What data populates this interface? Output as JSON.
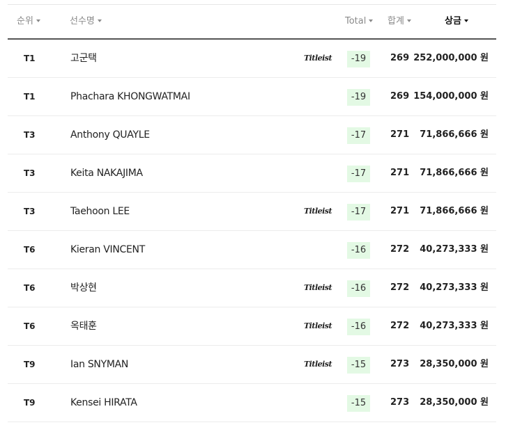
{
  "header": {
    "rank": "순위",
    "name": "선수명",
    "total": "Total",
    "sum": "합계",
    "prize": "상금"
  },
  "sponsor_logo": "Titleist",
  "currency": "원",
  "rows": [
    {
      "rank": "T1",
      "name": "고군택",
      "sponsor": "Titleist",
      "total": "-19",
      "sum": "269",
      "prize": "252,000,000 원"
    },
    {
      "rank": "T1",
      "name": "Phachara KHONGWATMAI",
      "sponsor": "",
      "total": "-19",
      "sum": "269",
      "prize": "154,000,000 원"
    },
    {
      "rank": "T3",
      "name": "Anthony QUAYLE",
      "sponsor": "",
      "total": "-17",
      "sum": "271",
      "prize": "71,866,666 원"
    },
    {
      "rank": "T3",
      "name": "Keita NAKAJIMA",
      "sponsor": "",
      "total": "-17",
      "sum": "271",
      "prize": "71,866,666 원"
    },
    {
      "rank": "T3",
      "name": "Taehoon LEE",
      "sponsor": "Titleist",
      "total": "-17",
      "sum": "271",
      "prize": "71,866,666 원"
    },
    {
      "rank": "T6",
      "name": "Kieran VINCENT",
      "sponsor": "",
      "total": "-16",
      "sum": "272",
      "prize": "40,273,333 원"
    },
    {
      "rank": "T6",
      "name": "박상현",
      "sponsor": "Titleist",
      "total": "-16",
      "sum": "272",
      "prize": "40,273,333 원"
    },
    {
      "rank": "T6",
      "name": "옥태훈",
      "sponsor": "Titleist",
      "total": "-16",
      "sum": "272",
      "prize": "40,273,333 원"
    },
    {
      "rank": "T9",
      "name": "Ian SNYMAN",
      "sponsor": "Titleist",
      "total": "-15",
      "sum": "273",
      "prize": "28,350,000 원"
    },
    {
      "rank": "T9",
      "name": "Kensei HIRATA",
      "sponsor": "",
      "total": "-15",
      "sum": "273",
      "prize": "28,350,000 원"
    }
  ],
  "colors": {
    "score_badge_bg": "#e3f9e4",
    "header_text": "#8a8a8a",
    "active_header_text": "#111111",
    "divider": "#555555"
  }
}
